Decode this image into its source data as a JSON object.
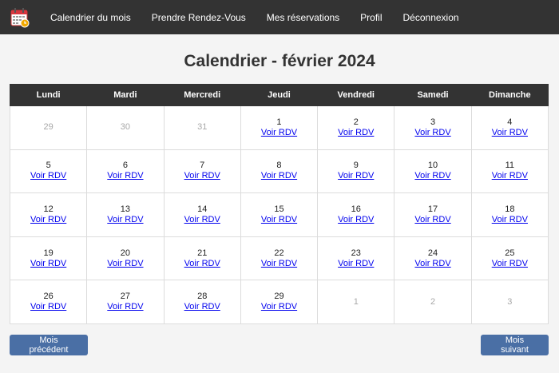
{
  "nav": {
    "links": [
      "Calendrier du mois",
      "Prendre Rendez-Vous",
      "Mes réservations",
      "Profil",
      "Déconnexion"
    ]
  },
  "page": {
    "title": "Calendrier - février 2024"
  },
  "calendar": {
    "weekdays": [
      "Lundi",
      "Mardi",
      "Mercredi",
      "Jeudi",
      "Vendredi",
      "Samedi",
      "Dimanche"
    ],
    "link_label": "Voir RDV",
    "weeks": [
      [
        {
          "day": "29",
          "current": false
        },
        {
          "day": "30",
          "current": false
        },
        {
          "day": "31",
          "current": false
        },
        {
          "day": "1",
          "current": true
        },
        {
          "day": "2",
          "current": true
        },
        {
          "day": "3",
          "current": true
        },
        {
          "day": "4",
          "current": true
        }
      ],
      [
        {
          "day": "5",
          "current": true
        },
        {
          "day": "6",
          "current": true
        },
        {
          "day": "7",
          "current": true
        },
        {
          "day": "8",
          "current": true
        },
        {
          "day": "9",
          "current": true
        },
        {
          "day": "10",
          "current": true
        },
        {
          "day": "11",
          "current": true
        }
      ],
      [
        {
          "day": "12",
          "current": true
        },
        {
          "day": "13",
          "current": true
        },
        {
          "day": "14",
          "current": true
        },
        {
          "day": "15",
          "current": true
        },
        {
          "day": "16",
          "current": true
        },
        {
          "day": "17",
          "current": true
        },
        {
          "day": "18",
          "current": true
        }
      ],
      [
        {
          "day": "19",
          "current": true
        },
        {
          "day": "20",
          "current": true
        },
        {
          "day": "21",
          "current": true
        },
        {
          "day": "22",
          "current": true
        },
        {
          "day": "23",
          "current": true
        },
        {
          "day": "24",
          "current": true
        },
        {
          "day": "25",
          "current": true
        }
      ],
      [
        {
          "day": "26",
          "current": true
        },
        {
          "day": "27",
          "current": true
        },
        {
          "day": "28",
          "current": true
        },
        {
          "day": "29",
          "current": true
        },
        {
          "day": "1",
          "current": false
        },
        {
          "day": "2",
          "current": false
        },
        {
          "day": "3",
          "current": false
        }
      ]
    ]
  },
  "buttons": {
    "prev_label": "Mois précédent",
    "next_label": "Mois suivant"
  },
  "icons": {
    "logo": "calendar-clock-icon"
  },
  "colors": {
    "navbar": "#333333",
    "button": "#4a6fa5",
    "link": "#0000ee",
    "muted_day": "#a8a8a8"
  }
}
